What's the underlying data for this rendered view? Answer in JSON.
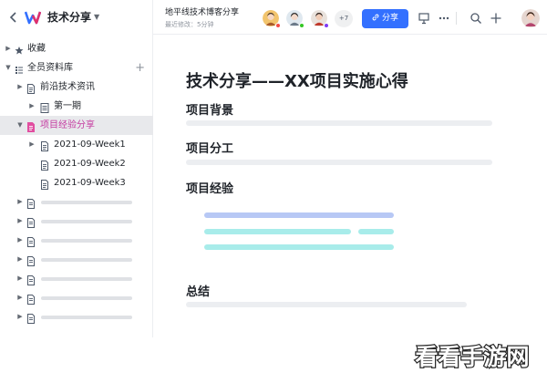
{
  "app": {
    "title": "技术分享"
  },
  "sidebar": {
    "items": [
      {
        "label": "收藏",
        "icon": "star-icon"
      },
      {
        "label": "全员资料库",
        "icon": "library-icon"
      },
      {
        "label": "前沿技术资讯",
        "icon": "doc-icon"
      },
      {
        "label": "第一期",
        "icon": "sheet-icon"
      },
      {
        "label": "项目经验分享",
        "icon": "doc-icon-pink"
      },
      {
        "label": "2021-09-Week1",
        "icon": "doc-icon"
      },
      {
        "label": "2021-09-Week2",
        "icon": "doc-icon"
      },
      {
        "label": "2021-09-Week3",
        "icon": "doc-icon"
      }
    ]
  },
  "header": {
    "doc_title": "地平线技术博客分享",
    "meta": "最近修改：5分钟",
    "more_count": "+7",
    "share_label": "分享"
  },
  "document": {
    "title": "技术分享——XX项目实施心得",
    "sections": [
      "项目背景",
      "项目分工",
      "项目经验",
      "总结"
    ]
  },
  "watermark": {
    "text": "看看手游网"
  },
  "colors": {
    "accent": "#3370ff",
    "active_label": "#c43aa0",
    "highlight_blue": "#b7c8f5",
    "highlight_teal": "#a8ecea"
  }
}
